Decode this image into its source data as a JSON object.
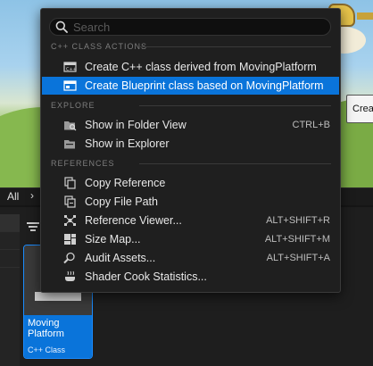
{
  "background": {
    "tooltip_fragment": "Crea",
    "tab_label": "All",
    "tab_chevron": "›",
    "asset": {
      "name": "Moving Platform",
      "type": "C++ Class"
    }
  },
  "menu": {
    "search_placeholder": "Search",
    "sections": {
      "cpp": "C++ CLASS ACTIONS",
      "explore": "EXPLORE",
      "references": "REFERENCES"
    },
    "items": [
      {
        "label": "Create C++ class derived from MovingPlatform",
        "shortcut": "",
        "icon": "cpp-class-icon"
      },
      {
        "label": "Create Blueprint class based on MovingPlatform",
        "shortcut": "",
        "icon": "blueprint-class-icon",
        "highlighted": true
      },
      {
        "label": "Show in Folder View",
        "shortcut": "CTRL+B",
        "icon": "folder-search-icon"
      },
      {
        "label": "Show in Explorer",
        "shortcut": "",
        "icon": "explorer-folder-icon"
      },
      {
        "label": "Copy Reference",
        "shortcut": "",
        "icon": "copy-reference-icon"
      },
      {
        "label": "Copy File Path",
        "shortcut": "",
        "icon": "copy-path-icon"
      },
      {
        "label": "Reference Viewer...",
        "shortcut": "ALT+SHIFT+R",
        "icon": "reference-viewer-icon"
      },
      {
        "label": "Size Map...",
        "shortcut": "ALT+SHIFT+M",
        "icon": "size-map-icon"
      },
      {
        "label": "Audit Assets...",
        "shortcut": "ALT+SHIFT+A",
        "icon": "audit-icon"
      },
      {
        "label": "Shader Cook Statistics...",
        "shortcut": "",
        "icon": "shader-cook-icon"
      }
    ]
  },
  "colors": {
    "highlight": "#0a74da",
    "menu_bg": "#1f1f1f",
    "text": "#e8e8e8"
  }
}
